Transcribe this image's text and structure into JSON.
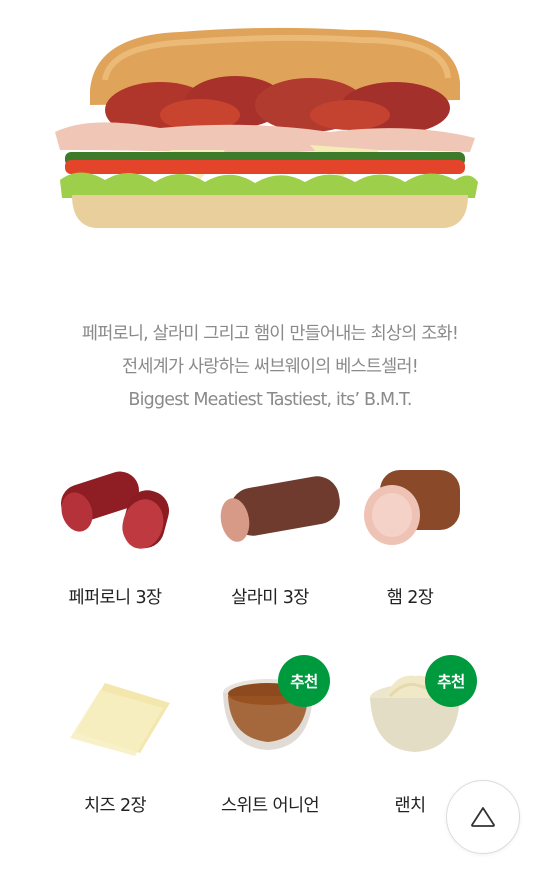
{
  "description": {
    "line1": "페퍼로니, 살라미 그리고 햄이 만들어내는 최상의 조화!",
    "line2": "전세계가 사랑하는 써브웨이의 베스트셀러!",
    "line3": "Biggest Meatiest Tastiest, its’ B.M.T."
  },
  "ingredients": [
    {
      "label": "페퍼로니 3장"
    },
    {
      "label": "살라미 3장"
    },
    {
      "label": "햄 2장"
    },
    {
      "label": "치즈 2장"
    },
    {
      "label": "스위트 어니언",
      "badge": "추천"
    },
    {
      "label": "랜치",
      "badge": "추천"
    }
  ],
  "colors": {
    "badge": "#009a3e",
    "description_text": "#8a8a8a"
  },
  "icons": {
    "top_button": "triangle-up-icon"
  }
}
